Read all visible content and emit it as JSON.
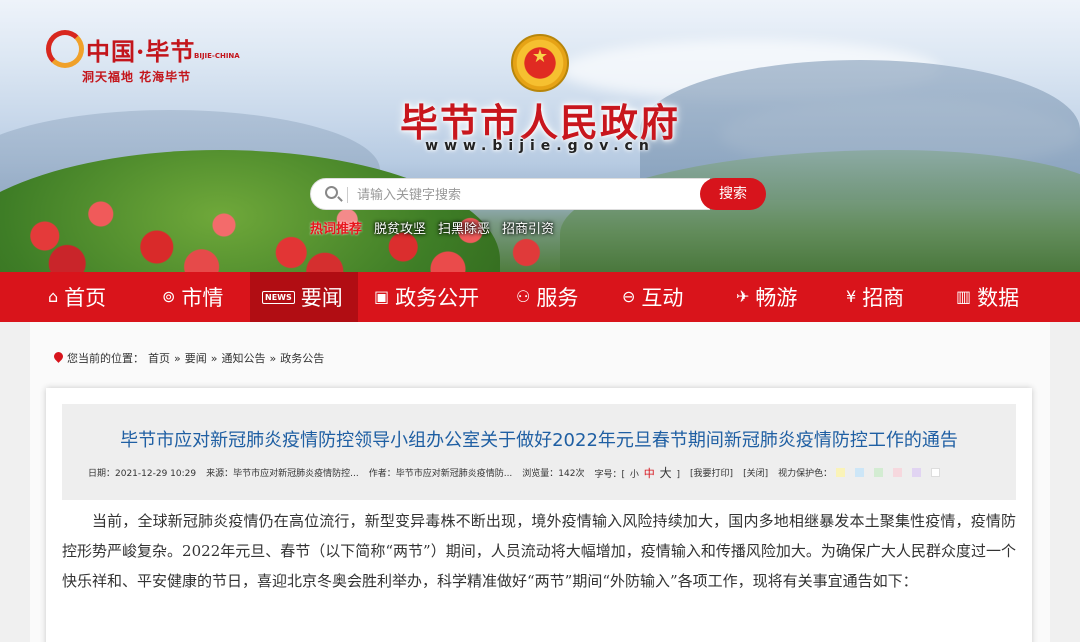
{
  "header": {
    "logo_title": "中国·毕节",
    "logo_en": "BIJIE-CHINA",
    "logo_slogan": "洞天福地  花海毕节",
    "site_title": "毕节市人民政府",
    "site_url": "www.bijie.gov.cn"
  },
  "search": {
    "placeholder": "请输入关键字搜索",
    "button_label": "搜索",
    "hot_links": [
      "热词推荐",
      "脱贫攻坚",
      "扫黑除恶",
      "招商引资"
    ]
  },
  "nav": {
    "items": [
      {
        "label": "首页",
        "icon": "home-icon"
      },
      {
        "label": "市情",
        "icon": "pulse-icon"
      },
      {
        "label": "要闻",
        "icon": "news-icon",
        "badge": "NEWS"
      },
      {
        "label": "政务公开",
        "icon": "id-card-icon"
      },
      {
        "label": "服务",
        "icon": "people-icon"
      },
      {
        "label": "互动",
        "icon": "chat-icon"
      },
      {
        "label": "畅游",
        "icon": "plane-icon"
      },
      {
        "label": "招商",
        "icon": "yuan-icon"
      },
      {
        "label": "数据",
        "icon": "bar-chart-icon"
      }
    ],
    "active_index": 2
  },
  "breadcrumb": {
    "prefix": "您当前的位置：",
    "items": [
      "首页",
      "要闻",
      "通知公告",
      "政务公告"
    ],
    "separator": "»"
  },
  "article": {
    "title": "毕节市应对新冠肺炎疫情防控领导小组办公室关于做好2022年元旦春节期间新冠肺炎疫情防控工作的通告",
    "meta": {
      "date": "日期：2021-12-29 10:29",
      "source": "来源：毕节市应对新冠肺炎疫情防控...",
      "author": "作者：毕节市应对新冠肺炎疫情防...",
      "views": "浏览量：142次",
      "font_size_label": "字号：[",
      "size_small": "小",
      "size_medium": "中",
      "size_large": "大",
      "font_size_close": "]",
      "print": "[我要打印]",
      "close": "[关闭]",
      "eye_protection": "视力保护色："
    },
    "eye_colors": [
      "#faf3b8",
      "#cde6f7",
      "#d3ecd2",
      "#f6d8de",
      "#e1d4f2",
      "#ffffff"
    ],
    "body": "当前，全球新冠肺炎疫情仍在高位流行，新型变异毒株不断出现，境外疫情输入风险持续加大，国内多地相继暴发本土聚集性疫情，疫情防控形势严峻复杂。2022年元旦、春节（以下简称“两节”）期间，人员流动将大幅增加，疫情输入和传播风险加大。为确保广大人民群众度过一个快乐祥和、平安健康的节日，喜迎北京冬奥会胜利举办，科学精准做好“两节”期间“外防输入”各项工作，现将有关事宜通告如下："
  }
}
